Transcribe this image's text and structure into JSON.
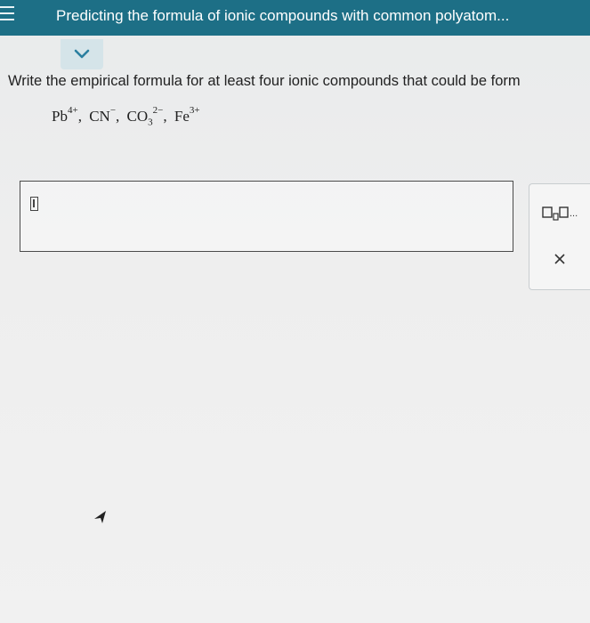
{
  "header": {
    "title": "Predicting the formula of ionic compounds with common polyatom..."
  },
  "question": {
    "prompt": "Write the empirical formula for at least four ionic compounds that could be form",
    "ions": [
      {
        "base": "Pb",
        "sub": "",
        "charge": "4+",
        "sep": ","
      },
      {
        "base": "CN",
        "sub": "",
        "charge": "−",
        "sep": ","
      },
      {
        "base": "CO",
        "sub": "3",
        "charge": "2−",
        "sep": ","
      },
      {
        "base": "Fe",
        "sub": "",
        "charge": "3+",
        "sep": ""
      }
    ]
  },
  "answer": {
    "value": ""
  },
  "toolbar": {
    "formula_button_icon": "subscript-template-icon",
    "formula_button_ellipsis": "...",
    "close_icon": "close-icon"
  },
  "colors": {
    "header_bg": "#1d6f86",
    "chevron_tab_bg": "#d5e4e9",
    "chevron": "#2a7fa0"
  }
}
